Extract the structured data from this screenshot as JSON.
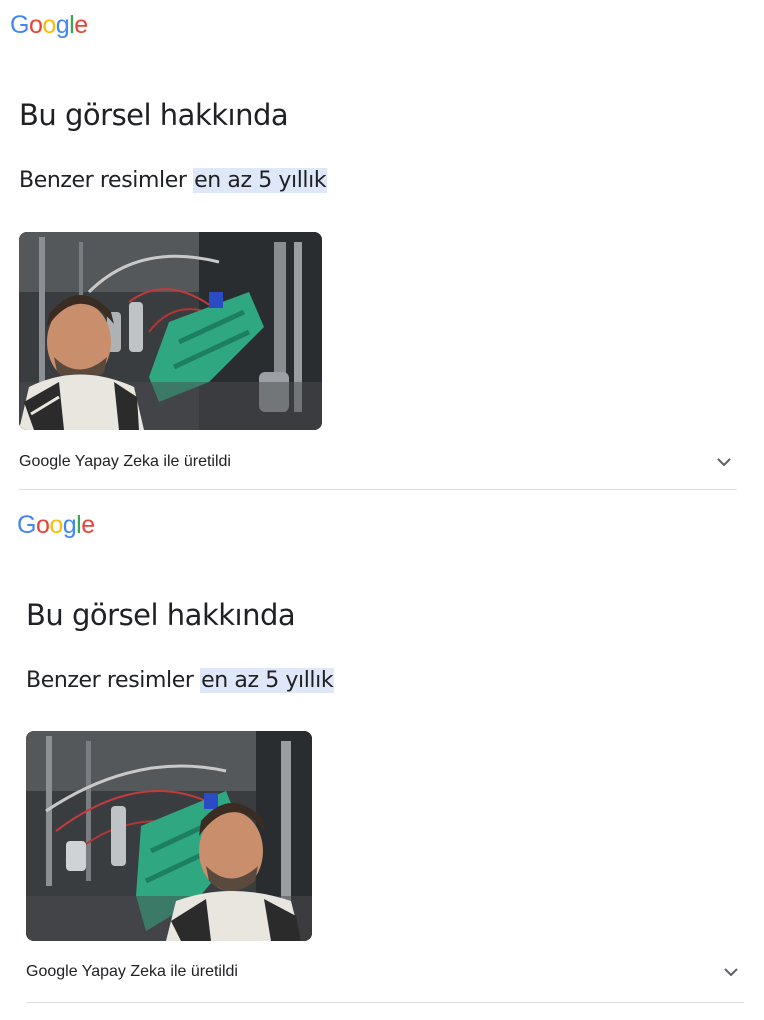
{
  "panels": [
    {
      "logo": {
        "letters": [
          "G",
          "o",
          "o",
          "g",
          "l",
          "e"
        ],
        "colors": [
          "#4285F4",
          "#EA4335",
          "#FBBC05",
          "#4285F4",
          "#34A853",
          "#EA4335"
        ]
      },
      "title": "Bu görsel hakkında",
      "similar_label": "Benzer resimler",
      "similar_highlight": "en az 5 yıllık",
      "image_icon": "photo-thumbnail",
      "ai_label": "Google Yapay Zeka ile üretildi",
      "expand_icon": "chevron-down-icon"
    },
    {
      "logo": {
        "letters": [
          "G",
          "o",
          "o",
          "g",
          "l",
          "e"
        ],
        "colors": [
          "#4285F4",
          "#EA4335",
          "#FBBC05",
          "#4285F4",
          "#34A853",
          "#EA4335"
        ]
      },
      "title": "Bu görsel hakkında",
      "similar_label": "Benzer resimler",
      "similar_highlight": "en az 5 yıllık",
      "image_icon": "photo-thumbnail",
      "ai_label": "Google Yapay Zeka ile üretildi",
      "expand_icon": "chevron-down-icon"
    }
  ],
  "colors": {
    "highlight": "#dfe8f8",
    "text": "#202124",
    "divider": "#dadce0"
  }
}
